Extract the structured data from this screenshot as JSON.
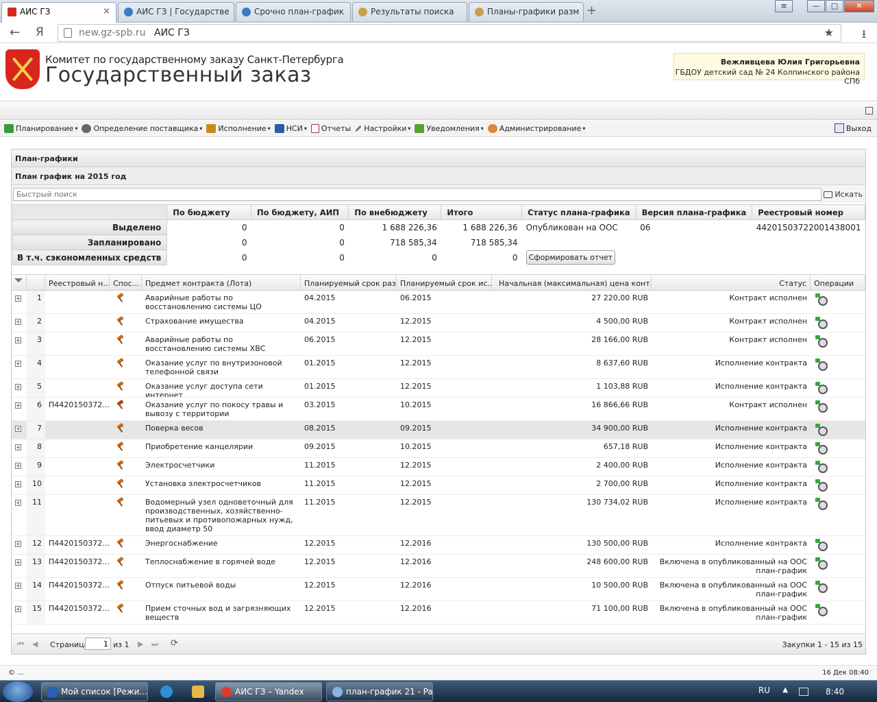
{
  "browser": {
    "tabs": [
      {
        "label": "АИС ГЗ",
        "active": true
      },
      {
        "label": "АИС ГЗ | Государстве",
        "active": false
      },
      {
        "label": "Срочно план-график",
        "active": false
      },
      {
        "label": "Результаты поиска",
        "active": false
      },
      {
        "label": "Планы-графики разм",
        "active": false
      }
    ],
    "close_glyph": "×",
    "new_tab_glyph": "+",
    "back_glyph": "←",
    "yandex_glyph": "Я",
    "url": "new.gz-spb.ru",
    "page_title": "АИС ГЗ",
    "star_glyph": "★",
    "download_glyph": "⭳",
    "win_min": "—",
    "win_max": "□",
    "win_close": "✕"
  },
  "header": {
    "org_line1": "Комитет по государственному заказу Санкт-Петербурга",
    "org_line2": "Государственный заказ",
    "user_name": "Вежливцева Юлия Григорьевна",
    "user_org": "ГБДОУ детский сад № 24 Колпинского района СПб"
  },
  "menu": {
    "items": [
      {
        "label": "Планирование",
        "icon": "planning-icon",
        "color": "#3a9a3a",
        "dropdown": true
      },
      {
        "label": "Определение поставщика",
        "icon": "supplier-icon",
        "color": "#666666",
        "dropdown": true
      },
      {
        "label": "Исполнение",
        "icon": "execution-icon",
        "color": "#c98a1a",
        "dropdown": true
      },
      {
        "label": "НСИ",
        "icon": "book-icon",
        "color": "#2a5aa8",
        "dropdown": true
      },
      {
        "label": "Отчеты",
        "icon": "report-icon",
        "color": "#b03030",
        "dropdown": false
      },
      {
        "label": "Настройки",
        "icon": "wrench-icon",
        "color": "#777777",
        "dropdown": true
      },
      {
        "label": "Уведомления",
        "icon": "notification-icon",
        "color": "#5aa02c",
        "dropdown": true
      },
      {
        "label": "Администрирование",
        "icon": "user-icon",
        "color": "#d9893a",
        "dropdown": true
      }
    ],
    "dropdown_glyph": "▾",
    "exit_label": "Выход"
  },
  "panel": {
    "title": "План-графики",
    "subtitle": "План график на 2015 год",
    "search_placeholder": "Быстрый поиск",
    "search_button": "Искать"
  },
  "summary": {
    "headers": [
      "По бюджету",
      "По бюджету, АИП",
      "По внебюджету",
      "Итого",
      "Статус плана-графика",
      "Версия плана-графика",
      "Реестровый номер"
    ],
    "rows": [
      {
        "label": "Выделено",
        "values": [
          "0",
          "0",
          "1 688 226,36",
          "1 688 226,36"
        ]
      },
      {
        "label": "Запланировано",
        "values": [
          "0",
          "0",
          "718 585,34",
          "718 585,34"
        ]
      },
      {
        "label": "В т.ч. сэкономленных средств",
        "values": [
          "0",
          "0",
          "0",
          "0"
        ]
      }
    ],
    "status": "Опубликован на ООС",
    "version": "06",
    "registry_number": "4420150372200143800​1",
    "report_button": "Сформировать отчет"
  },
  "grid": {
    "columns": [
      "Реестровый н...",
      "Спос...",
      "Предмет контракта (Лота)",
      "Планируемый срок раз...",
      "Планируемый срок ис...",
      "Начальная (максимальная) цена конт...",
      "Статус",
      "Операции"
    ],
    "expand_glyph": "+",
    "rows": [
      {
        "n": "1",
        "reg": "",
        "subject": "Аварийные работы по восстановлению системы ЦО",
        "d1": "04.2015",
        "d2": "06.2015",
        "price": "27 220,00 RUB",
        "status": "Контракт исполнен"
      },
      {
        "n": "2",
        "reg": "",
        "subject": "Страхование имущества",
        "d1": "04.2015",
        "d2": "12.2015",
        "price": "4 500,00 RUB",
        "status": "Контракт исполнен"
      },
      {
        "n": "3",
        "reg": "",
        "subject": "Аварийные работы по восстановлению системы ХВС",
        "d1": "06.2015",
        "d2": "12.2015",
        "price": "28 166,00 RUB",
        "status": "Контракт исполнен"
      },
      {
        "n": "4",
        "reg": "",
        "subject": "Оказание услуг по внутризоновой телефонной связи",
        "d1": "01.2015",
        "d2": "12.2015",
        "price": "8 637,60 RUB",
        "status": "Исполнение контракта"
      },
      {
        "n": "5",
        "reg": "",
        "subject": "Оказание услуг доступа сети интернет",
        "d1": "01.2015",
        "d2": "12.2015",
        "price": "1 103,88 RUB",
        "status": "Исполнение контракта"
      },
      {
        "n": "6",
        "reg": "П4420150372...",
        "subject": "Оказание услуг по покосу травы и вывозу с территории",
        "d1": "03.2015",
        "d2": "10.2015",
        "price": "16 866,66 RUB",
        "status": "Контракт исполнен"
      },
      {
        "n": "7",
        "reg": "",
        "subject": "Поверка весов",
        "d1": "08.2015",
        "d2": "09.2015",
        "price": "34 900,00 RUB",
        "status": "Исполнение контракта"
      },
      {
        "n": "8",
        "reg": "",
        "subject": "Приобретение канцелярии",
        "d1": "09.2015",
        "d2": "10.2015",
        "price": "657,18 RUB",
        "status": "Исполнение контракта"
      },
      {
        "n": "9",
        "reg": "",
        "subject": "Электросчетчики",
        "d1": "11.2015",
        "d2": "12.2015",
        "price": "2 400,00 RUB",
        "status": "Исполнение контракта"
      },
      {
        "n": "10",
        "reg": "",
        "subject": "Установка электросчетчиков",
        "d1": "11.2015",
        "d2": "12.2015",
        "price": "2 700,00 RUB",
        "status": "Исполнение контракта"
      },
      {
        "n": "11",
        "reg": "",
        "subject": "Водомерный узел одноветочный для производственных, хозяйственно-питьевых и противопожарных нужд, ввод диаметр 50",
        "d1": "11.2015",
        "d2": "12.2015",
        "price": "130 734,02 RUB",
        "status": "Исполнение контракта"
      },
      {
        "n": "12",
        "reg": "П4420150372...",
        "subject": "Энергоснабжение",
        "d1": "12.2015",
        "d2": "12.2016",
        "price": "130 500,00 RUB",
        "status": "Исполнение контракта"
      },
      {
        "n": "13",
        "reg": "П4420150372...",
        "subject": "Теплоснабжение в горячей воде",
        "d1": "12.2015",
        "d2": "12.2016",
        "price": "248 600,00 RUB",
        "status": "Включена в опубликованный на ООС план-график"
      },
      {
        "n": "14",
        "reg": "П4420150372...",
        "subject": "Отпуск питьевой воды",
        "d1": "12.2015",
        "d2": "12.2016",
        "price": "10 500,00 RUB",
        "status": "Включена в опубликованный на ООС план-график"
      },
      {
        "n": "15",
        "reg": "П4420150372...",
        "subject": "Прием сточных вод и загрязняющих веществ",
        "d1": "12.2015",
        "d2": "12.2016",
        "price": "71 100,00 RUB",
        "status": "Включена в опубликованный на ООС план-график"
      }
    ]
  },
  "pager": {
    "first": "⏮",
    "prev": "◀",
    "next": "▶",
    "last": "⏭",
    "refresh": "⟳",
    "page_label": "Страница",
    "page_value": "1",
    "of_label": "из 1",
    "info": "Закупки 1 - 15 из 15"
  },
  "footer": {
    "left": "© ...",
    "right": "16 Дек 08:40"
  },
  "taskbar": {
    "items": [
      "Мой список [Режи...",
      "АИС ГЗ – Yandex",
      "план-график 21 - Pa..."
    ],
    "lang": "RU",
    "tray_arrow": "▲",
    "clock": "8:40"
  }
}
